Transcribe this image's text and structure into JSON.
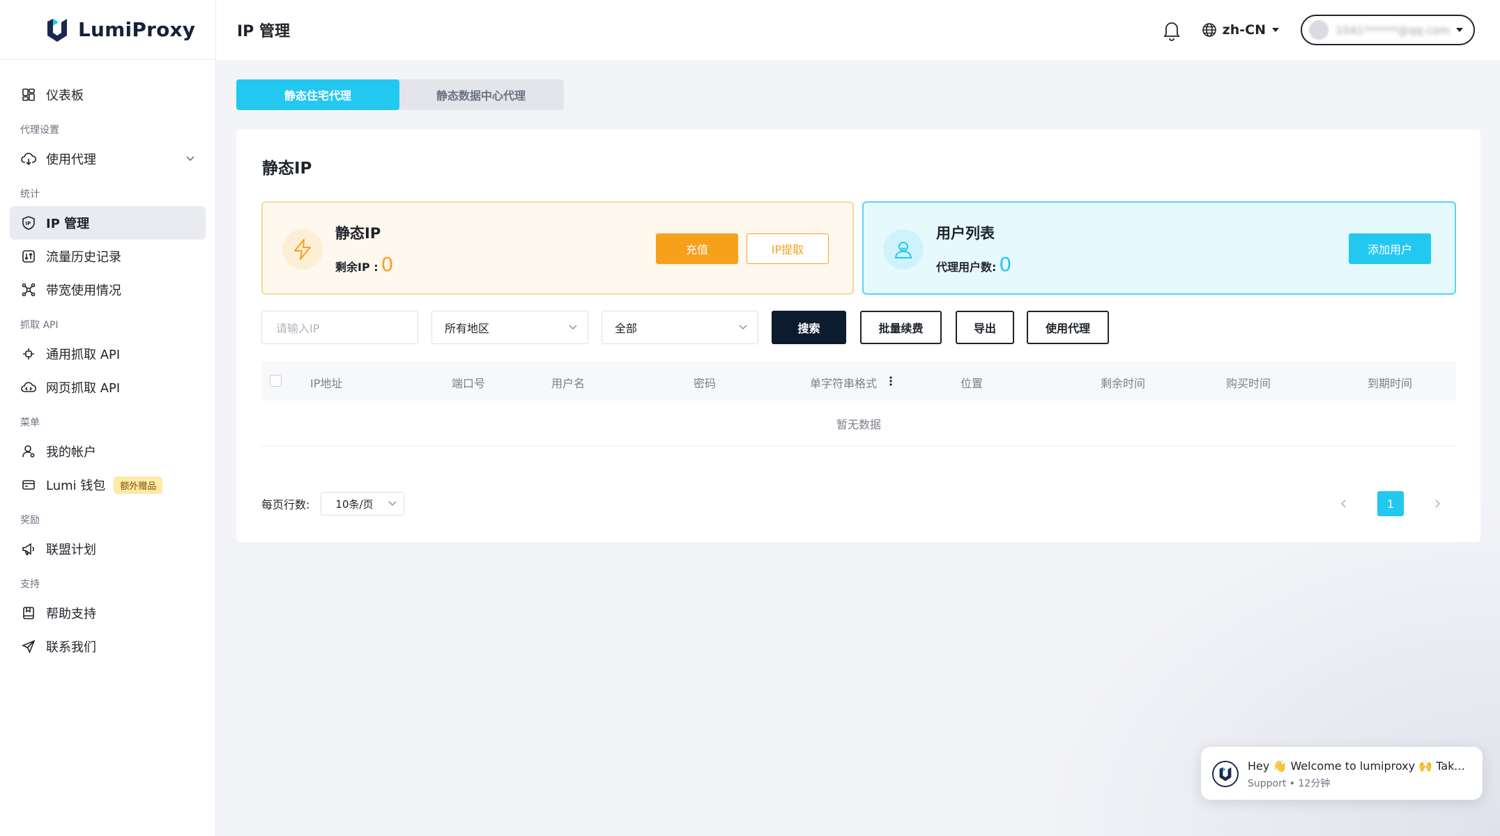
{
  "app": {
    "name": "LumiProxy"
  },
  "header": {
    "title": "IP 管理",
    "language": "zh-CN",
    "user_email": "1041******@qq.com"
  },
  "sidebar": {
    "dashboard": "仪表板",
    "group_proxy": "代理设置",
    "use_proxy": "使用代理",
    "group_stats": "统计",
    "ip_manage": "IP 管理",
    "traffic_history": "流量历史记录",
    "bandwidth": "带宽使用情况",
    "group_scrape": "抓取 API",
    "general_scrape": "通用抓取 API",
    "web_scrape": "网页抓取 API",
    "group_menu": "菜单",
    "my_account": "我的帐户",
    "wallet": "Lumi 钱包",
    "wallet_badge": "额外赠品",
    "group_rewards": "奖励",
    "affiliate": "联盟计划",
    "group_support": "支持",
    "help": "帮助支持",
    "contact": "联系我们"
  },
  "tabs": [
    "静态住宅代理",
    "静态数据中心代理"
  ],
  "card": {
    "title": "静态IP",
    "static_panel": {
      "title": "静态IP",
      "stat_label": "剩余IP :",
      "stat_value": "0",
      "recharge": "充值",
      "extract": "IP提取"
    },
    "users_panel": {
      "title": "用户列表",
      "stat_label": "代理用户数:",
      "stat_value": "0",
      "add_user": "添加用户"
    }
  },
  "filters": {
    "ip_placeholder": "请输入IP",
    "region": "所有地区",
    "status": "全部",
    "search": "搜索",
    "batch_renew": "批量续费",
    "export": "导出",
    "use_proxy": "使用代理"
  },
  "table": {
    "columns": [
      "IP地址",
      "端口号",
      "用户名",
      "密码",
      "单字符串格式",
      "位置",
      "剩余时间",
      "购买时间",
      "到期时间"
    ],
    "empty": "暂无数据"
  },
  "pagination": {
    "per_page_label": "每页行数:",
    "per_page_value": "10条/页",
    "current_page": "1"
  },
  "chat": {
    "message": "Hey 👋 Welcome to lumiproxy 🙌 Take a look around!",
    "meta": "Support • 12分钟"
  },
  "colors": {
    "accent": "#22c8f0",
    "orange": "#f7a11b",
    "dark": "#0d1b2e"
  }
}
